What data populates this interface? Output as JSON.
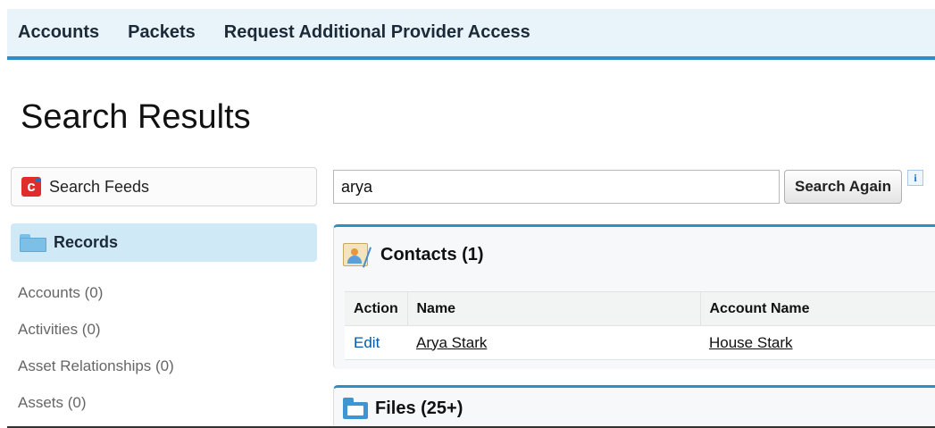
{
  "nav": {
    "tabs": [
      {
        "label": "Accounts"
      },
      {
        "label": "Packets"
      },
      {
        "label": "Request Additional Provider Access"
      }
    ]
  },
  "page": {
    "title": "Search Results"
  },
  "sidebar": {
    "search_feeds_label": "Search Feeds",
    "records_label": "Records",
    "objects": [
      {
        "label": "Accounts (0)"
      },
      {
        "label": "Activities (0)"
      },
      {
        "label": "Asset Relationships (0)"
      },
      {
        "label": "Assets (0)"
      }
    ]
  },
  "search": {
    "value": "arya",
    "button_label": "Search Again",
    "info_label": "i"
  },
  "contacts": {
    "title": "Contacts (1)",
    "columns": [
      "Action",
      "Name",
      "Account Name"
    ],
    "rows": [
      {
        "action": "Edit",
        "name": "Arya Stark",
        "account": "House Stark"
      }
    ]
  },
  "files": {
    "title": "Files (25+)"
  },
  "colors": {
    "accent": "#2d8fc6",
    "nav_bg": "#e9f4fa",
    "records_bg": "#cfe9f7",
    "link": "#015ba7"
  },
  "icons": {
    "search_feeds": "chatter-feed-icon",
    "records": "folder-icon",
    "contacts": "contact-card-icon",
    "files": "files-folder-icon",
    "info": "info-icon"
  }
}
